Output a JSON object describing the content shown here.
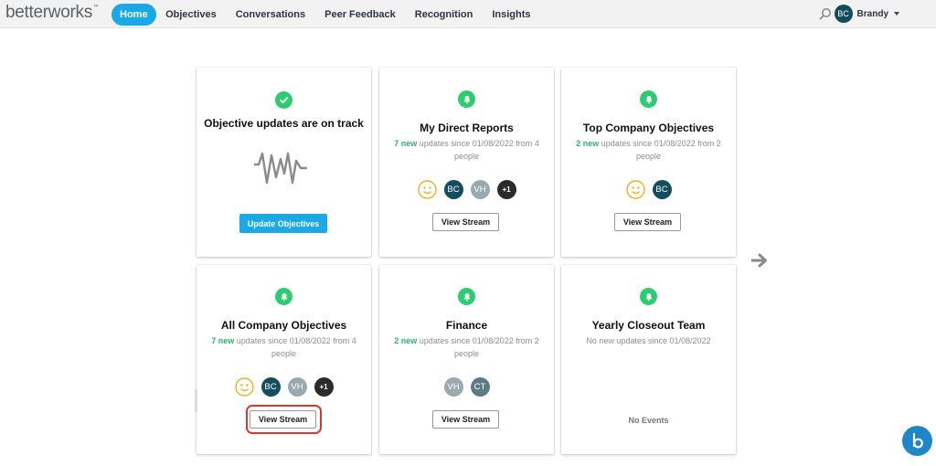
{
  "app": {
    "logo": "betterworks"
  },
  "nav": {
    "items": [
      {
        "label": "Home",
        "active": true
      },
      {
        "label": "Objectives"
      },
      {
        "label": "Conversations"
      },
      {
        "label": "Peer Feedback"
      },
      {
        "label": "Recognition"
      },
      {
        "label": "Insights"
      }
    ]
  },
  "header": {
    "search_icon": "search-icon",
    "bell_icon": "bell-icon",
    "user_initials": "BC",
    "user_name": "Brandy"
  },
  "cards": [
    {
      "title": "Objective updates are on track",
      "icon": "check-icon",
      "button": "Update Objectives"
    },
    {
      "title": "My Direct Reports",
      "icon": "bell-icon",
      "new_count": "7 new",
      "sub_text": " updates since 01/08/2022 from 4 people",
      "avatars": [
        "smiley",
        "BC",
        "VH",
        "+1"
      ],
      "button": "View Stream"
    },
    {
      "title": "Top Company Objectives",
      "icon": "bell-icon",
      "new_count": "2 new",
      "sub_text": " updates since 01/08/2022 from 2 people",
      "avatars": [
        "smiley",
        "BC"
      ],
      "button": "View Stream"
    },
    {
      "title": "All Company Objectives",
      "icon": "bell-icon",
      "new_count": "7 new",
      "sub_text": " updates since 01/08/2022 from 4 people",
      "avatars": [
        "smiley",
        "BC",
        "VH",
        "+1"
      ],
      "button": "View Stream",
      "highlighted": true
    },
    {
      "title": "Finance",
      "icon": "bell-icon",
      "new_count": "2 new",
      "sub_text": " updates since 01/08/2022 from 2 people",
      "avatars": [
        "VH",
        "CT"
      ],
      "button": "View Stream"
    },
    {
      "title": "Yearly Closeout Team",
      "icon": "bell-icon",
      "sub_text": "No new updates since 01/08/2022",
      "empty_text": "No Events"
    }
  ],
  "colors": {
    "accent": "#1aa9e6",
    "success": "#2ecc71",
    "highlight": "#e0352b",
    "avatar_dark": "#134e5e"
  }
}
